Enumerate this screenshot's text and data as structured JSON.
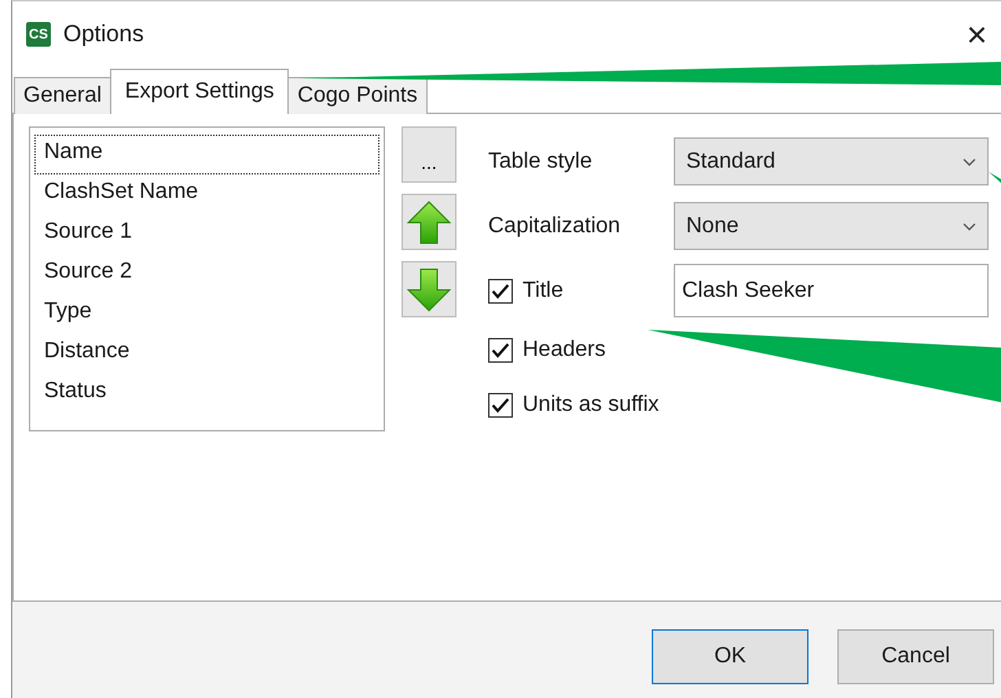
{
  "window": {
    "title": "Options",
    "app_icon": "CS",
    "close": "×"
  },
  "tabs": [
    {
      "label": "General",
      "selected": false
    },
    {
      "label": "Export Settings",
      "selected": true
    },
    {
      "label": "Cogo Points",
      "selected": false
    }
  ],
  "columns_list": {
    "items": [
      {
        "label": "Name",
        "selected": true
      },
      {
        "label": "ClashSet Name",
        "selected": false
      },
      {
        "label": "Source 1",
        "selected": false
      },
      {
        "label": "Source 2",
        "selected": false
      },
      {
        "label": "Type",
        "selected": false
      },
      {
        "label": "Distance",
        "selected": false
      },
      {
        "label": "Status",
        "selected": false
      }
    ]
  },
  "side_buttons": [
    {
      "kind": "text",
      "label": "..."
    },
    {
      "kind": "up"
    },
    {
      "kind": "down"
    }
  ],
  "options": [
    {
      "kind": "dropdown",
      "label": "Table style",
      "value": "Standard"
    },
    {
      "kind": "dropdown",
      "label": "Capitalization",
      "value": "None"
    },
    {
      "kind": "check_text",
      "label": "Title",
      "checked": true,
      "value": "Clash Seeker"
    },
    {
      "kind": "check",
      "label": "Headers",
      "checked": true
    },
    {
      "kind": "check",
      "label": "Units as suffix",
      "checked": true
    }
  ],
  "buttons": [
    {
      "label": "OK",
      "default": true
    },
    {
      "label": "Cancel",
      "default": false
    }
  ]
}
